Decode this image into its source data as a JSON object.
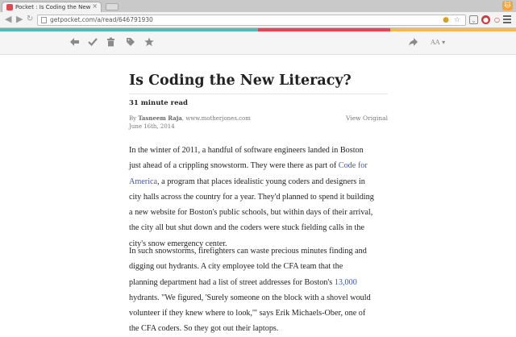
{
  "browser": {
    "tab_title": "Pocket : Is Coding the New",
    "tab_close": "×",
    "url": "getpocket.com/a/read/646791930"
  },
  "colors": {
    "stripe": [
      "#50bcb6",
      "#ef4056",
      "#fcb64e"
    ],
    "link": "#3b57b4",
    "text": "#222222"
  },
  "pocket_toolbar": {
    "left_icons": [
      "back-arrow-icon",
      "check-icon",
      "trash-icon",
      "tag-icon",
      "star-icon"
    ],
    "right_icons": [
      "share-icon",
      "text-size-icon"
    ],
    "text_size_label": "AA"
  },
  "article": {
    "title": "Is Coding the New Literacy?",
    "read_time": "31 minute read",
    "by": "By",
    "author": "Tasneem Raja",
    "source": ", www.motherjones.com",
    "date": "June 16th, 2014",
    "view_original": "View Original",
    "paragraph_1": {
      "l1": "In the winter of 2011, a handful of software engineers landed in Boston",
      "l2a": "just ahead of a crippling snowstorm. They were there as part of ",
      "l2link": "Code for",
      "l3link": "America",
      "l3b": ", a program that places idealistic young coders and designers in",
      "l4": "city halls across the country for a year. They'd planned to spend it building",
      "l5": "a new website for Boston's public schools, but within days of their arrival,",
      "l6": "the city all but shut down and the coders were stuck fielding calls in the",
      "l7": "city's snow emergency center."
    },
    "paragraph_2": {
      "l1": "In such snowstorms, firefighters can waste precious minutes finding and",
      "l2": "digging out hydrants. A city employee told the CFA team that the",
      "l3a": "planning department had a list of street addresses for Boston's ",
      "l3link": "13,000",
      "l4": "hydrants. \"We figured, 'Surely someone on the block with a shovel would",
      "l5": "volunteer if they knew where to look,'\" says Erik Michaels-Ober, one of",
      "l6": "the CFA coders. So they got out their laptops."
    }
  }
}
